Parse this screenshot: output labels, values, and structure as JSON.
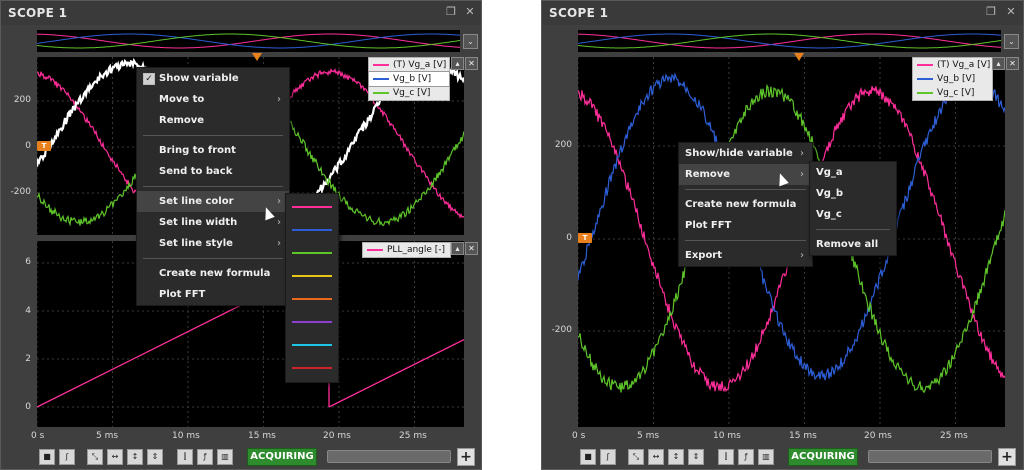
{
  "windows": [
    {
      "title": "SCOPE 1",
      "top_plot": {
        "y_ticks": [
          "200",
          "0",
          "-200"
        ],
        "legend": [
          {
            "label": "(T) Vg_a  [V]",
            "color": "#ff2e9a"
          },
          {
            "label": "Vg_b  [V]",
            "color": "#2d5ed6"
          },
          {
            "label": "Vg_c  [V]",
            "color": "#5ec42a"
          }
        ]
      },
      "bottom_plot": {
        "y_ticks": [
          "6",
          "4",
          "2",
          "0"
        ],
        "legend": [
          {
            "label": "PLL_angle  [-]",
            "color": "#ff2e9a"
          }
        ]
      },
      "x_ticks": [
        "0 s",
        "5 ms",
        "10 ms",
        "15 ms",
        "20 ms",
        "25 ms"
      ],
      "context_menu": {
        "show_variable": "Show variable",
        "move_to": "Move to",
        "remove": "Remove",
        "bring_to_front": "Bring to front",
        "send_to_back": "Send to back",
        "set_line_color": "Set line color",
        "set_line_width": "Set line width",
        "set_line_style": "Set line style",
        "create_formula": "Create new formula",
        "plot_fft": "Plot FFT"
      },
      "color_swatches": [
        "#ff2e9a",
        "#2d5ed6",
        "#5ec42a",
        "#e6c619",
        "#e8681e",
        "#8a3fd0",
        "#1ec6e6",
        "#d0202a"
      ],
      "status": "ACQUIRING"
    },
    {
      "title": "SCOPE 1",
      "plot": {
        "y_ticks": [
          "200",
          "0",
          "-200"
        ],
        "legend": [
          {
            "label": "(T) Vg_a  [V]",
            "color": "#ff2e9a"
          },
          {
            "label": "Vg_b  [V]",
            "color": "#2d5ed6"
          },
          {
            "label": "Vg_c  [V]",
            "color": "#5ec42a"
          }
        ]
      },
      "x_ticks": [
        "0 s",
        "5 ms",
        "10 ms",
        "15 ms",
        "20 ms",
        "25 ms"
      ],
      "context_menu": {
        "show_hide": "Show/hide variable",
        "remove": "Remove",
        "create_formula": "Create new formula",
        "plot_fft": "Plot FFT",
        "export": "Export"
      },
      "remove_submenu": {
        "items": [
          "Vg_a",
          "Vg_b",
          "Vg_c"
        ],
        "remove_all": "Remove all"
      },
      "status": "ACQUIRING"
    }
  ],
  "icons": {
    "trigger_marker": "T",
    "restore": "restore-icon",
    "close": "close-icon"
  }
}
